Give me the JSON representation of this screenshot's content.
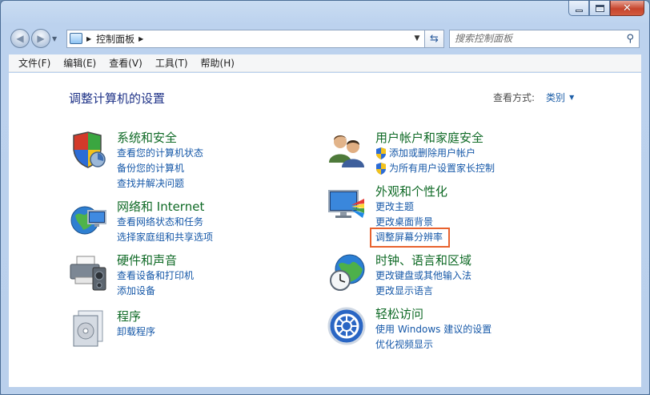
{
  "window": {
    "caption": {
      "minimize_icon": "minimize-icon",
      "maximize_icon": "maximize-icon",
      "close_glyph": "✕"
    }
  },
  "nav": {
    "address_path": "控制面板",
    "search_placeholder": "搜索控制面板"
  },
  "menu": [
    "文件(F)",
    "编辑(E)",
    "查看(V)",
    "工具(T)",
    "帮助(H)"
  ],
  "main": {
    "title": "调整计算机的设置",
    "view_by_label": "查看方式:",
    "view_by_value": "类别",
    "left_categories": [
      {
        "title": "系统和安全",
        "icon": "system-security-icon",
        "links": [
          "查看您的计算机状态",
          "备份您的计算机",
          "查找并解决问题"
        ]
      },
      {
        "title": "网络和 Internet",
        "icon": "network-internet-icon",
        "links": [
          "查看网络状态和任务",
          "选择家庭组和共享选项"
        ]
      },
      {
        "title": "硬件和声音",
        "icon": "hardware-sound-icon",
        "links": [
          "查看设备和打印机",
          "添加设备"
        ]
      },
      {
        "title": "程序",
        "icon": "programs-icon",
        "links": [
          "卸载程序"
        ]
      }
    ],
    "right_categories": [
      {
        "title": "用户帐户和家庭安全",
        "icon": "user-accounts-icon",
        "links": [
          "添加或删除用户帐户",
          "为所有用户设置家长控制"
        ]
      },
      {
        "title": "外观和个性化",
        "icon": "appearance-icon",
        "links": [
          "更改主题",
          "更改桌面背景",
          "调整屏幕分辨率"
        ]
      },
      {
        "title": "时钟、语言和区域",
        "icon": "clock-language-icon",
        "links": [
          "更改键盘或其他输入法",
          "更改显示语言"
        ]
      },
      {
        "title": "轻松访问",
        "icon": "ease-of-access-icon",
        "links": [
          "使用 Windows 建议的设置",
          "优化视频显示"
        ]
      }
    ],
    "highlight_color": "#e8622e"
  }
}
